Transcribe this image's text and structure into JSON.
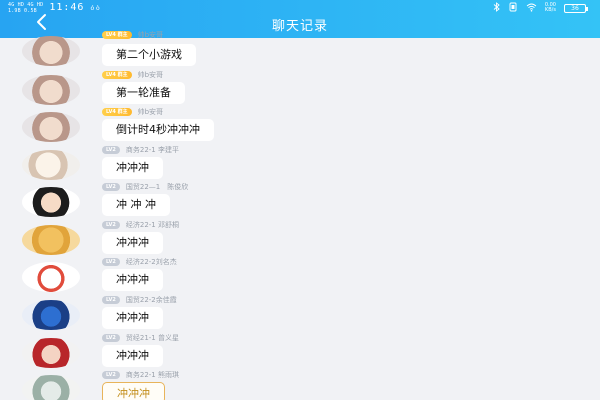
{
  "status_bar": {
    "net_top": "4G HD  4G HD",
    "net_bottom": "1.9B  0.5B",
    "time": "11:46",
    "suffix": "ó ò",
    "speed_top": "0.00",
    "speed_bottom": "KB/s",
    "battery": "36"
  },
  "header": {
    "title": "聊天记录"
  },
  "messages": [
    {
      "level": "LV4 群主",
      "nick": "帅b安哥",
      "text": "第二个小游戏"
    },
    {
      "level": "LV4 群主",
      "nick": "帅b安哥",
      "text": "第一轮准备"
    },
    {
      "level": "LV4 群主",
      "nick": "帅b安哥",
      "text": "倒计时4秒冲冲冲"
    },
    {
      "level": "LV2",
      "nick": "商务22-1 李建平",
      "text": "冲冲冲"
    },
    {
      "level": "LV2",
      "nick": "国贸22—1　陈俊欣",
      "text": "冲 冲 冲"
    },
    {
      "level": "LV2",
      "nick": "经济22-1 邓舒桐",
      "text": "冲冲冲"
    },
    {
      "level": "LV2",
      "nick": "经济22-2刘名杰",
      "text": "冲冲冲"
    },
    {
      "level": "LV2",
      "nick": "国贸22-2余佳霞",
      "text": "冲冲冲"
    },
    {
      "level": "LV2",
      "nick": "贸经21-1 曾义星",
      "text": "冲冲冲"
    },
    {
      "level": "LV2",
      "nick": "商务22-1 熊雨琪",
      "text": "冲冲冲"
    }
  ],
  "colors": {
    "header_start": "#27a4f2",
    "header_end": "#34c3f6",
    "background": "#f1f2f5",
    "owner_badge": "#ffc23a",
    "member_badge": "#c6ccd6"
  },
  "icons": {
    "back": "chevron-left-icon",
    "bluetooth": "bluetooth-icon",
    "wifi": "wifi-icon",
    "mute": "mute-icon",
    "battery": "battery-icon"
  }
}
